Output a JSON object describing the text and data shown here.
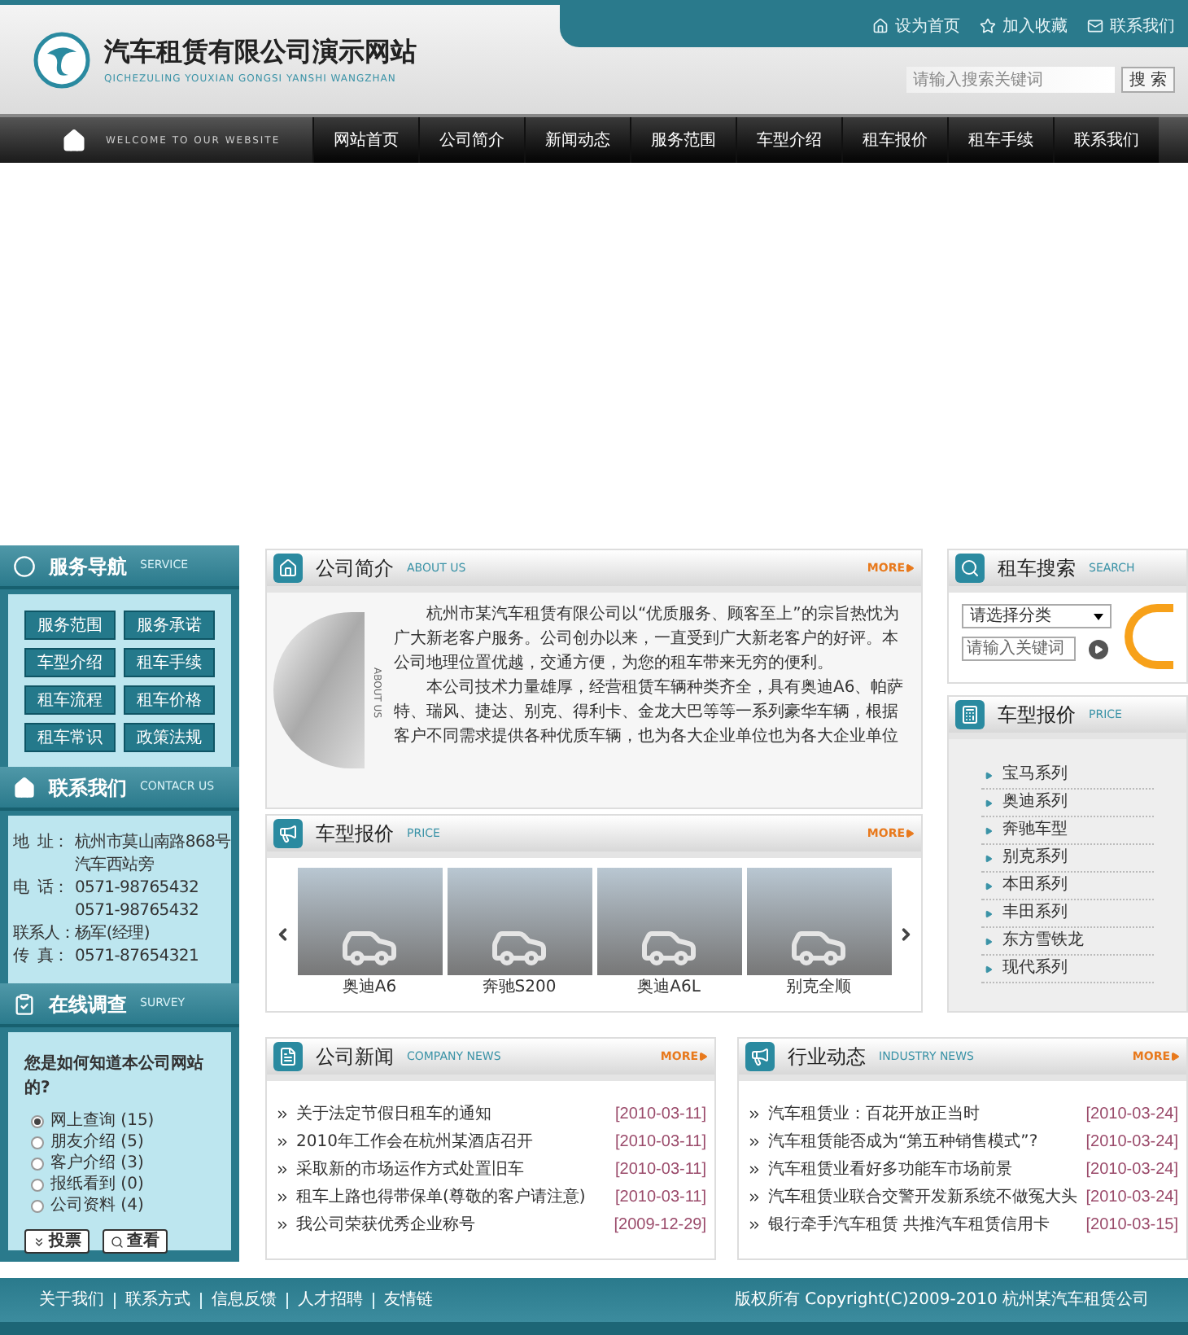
{
  "header": {
    "title": "汽车租赁有限公司演示网站",
    "subtitle": "QICHEZULING YOUXIAN GONGSI YANSHI WANGZHAN",
    "top_links": [
      {
        "label": "设为首页"
      },
      {
        "label": "加入收藏"
      },
      {
        "label": "联系我们"
      }
    ],
    "search": {
      "placeholder": "请输入搜索关键词",
      "button": "搜 索"
    }
  },
  "nav": {
    "welcome": "WELCOME TO OUR WEBSITE",
    "items": [
      "网站首页",
      "公司简介",
      "新闻动态",
      "服务范围",
      "车型介绍",
      "租车报价",
      "租车手续",
      "联系我们"
    ]
  },
  "service": {
    "title": "服务导航",
    "subtitle": "SERVICE",
    "items": [
      "服务范围",
      "服务承诺",
      "车型介绍",
      "租车手续",
      "租车流程",
      "租车价格",
      "租车常识",
      "政策法规"
    ]
  },
  "contact": {
    "title": "联系我们",
    "subtitle": "CONTACR US",
    "lines": [
      {
        "label": "地  址：",
        "value": "杭州市莫山南路868号"
      },
      {
        "value": "汽车西站旁"
      },
      {
        "label": "电  话：",
        "value": "0571-98765432"
      },
      {
        "value": "0571-98765432"
      },
      {
        "label": "联系人：",
        "value": "杨军(经理)"
      },
      {
        "label": "传  真：",
        "value": "0571-87654321"
      }
    ]
  },
  "survey": {
    "title": "在线调查",
    "subtitle": "SURVEY",
    "question": "您是如何知道本公司网站的?",
    "options": [
      {
        "label": "网上查询 (15)",
        "selected": true
      },
      {
        "label": "朋友介绍 (5)",
        "selected": false
      },
      {
        "label": "客户介绍 (3)",
        "selected": false
      },
      {
        "label": "报纸看到 (0)",
        "selected": false
      },
      {
        "label": "公司资料 (4)",
        "selected": false
      }
    ],
    "buttons": [
      "投票",
      "查看"
    ]
  },
  "about": {
    "title": "公司简介",
    "subtitle": "ABOUT US",
    "more": "MORE",
    "photo_label": "ABOUT US",
    "paragraphs": [
      "杭州市某汽车租赁有限公司以“优质服务、顾客至上”的宗旨热忱为广大新老客户服务。公司创办以来，一直受到广大新老客户的好评。本公司地理位置优越，交通方便，为您的租车带来无穷的便利。",
      "本公司技术力量雄厚，经营租赁车辆种类齐全，具有奥迪A6、帕萨特、瑞风、捷达、别克、得利卡、金龙大巴等等一系列豪华车辆，根据客户不同需求提供各种优质车辆，也为各大企业单位也为各大企业单位"
    ]
  },
  "price": {
    "title": "车型报价",
    "subtitle": "PRICE",
    "more": "MORE",
    "cars": [
      "奥迪A6",
      "奔驰S200",
      "奥迪A6L",
      "别克全顺"
    ]
  },
  "car_search": {
    "title": "租车搜索",
    "subtitle": "SEARCH",
    "select": "请选择分类",
    "placeholder": "请输入关键词"
  },
  "price_list": {
    "title": "车型报价",
    "subtitle": "PRICE",
    "items": [
      "宝马系列",
      "奥迪系列",
      "奔驰车型",
      "别克系列",
      "本田系列",
      "丰田系列",
      "东方雪铁龙",
      "现代系列"
    ]
  },
  "news": [
    {
      "title": "公司新闻",
      "subtitle": "COMPANY NEWS",
      "more": "MORE",
      "items": [
        {
          "text": "关于法定节假日租车的通知",
          "date": "[2010-03-11]"
        },
        {
          "text": "2010年工作会在杭州某酒店召开",
          "date": "[2010-03-11]"
        },
        {
          "text": "采取新的市场运作方式处置旧车",
          "date": "[2010-03-11]"
        },
        {
          "text": "租车上路也得带保单(尊敬的客户请注意)",
          "date": "[2010-03-11]"
        },
        {
          "text": "我公司荣获优秀企业称号",
          "date": "[2009-12-29]"
        }
      ]
    },
    {
      "title": "行业动态",
      "subtitle": "INDUSTRY NEWS",
      "more": "MORE",
      "items": [
        {
          "text": "汽车租赁业：百花开放正当时",
          "date": "[2010-03-24]"
        },
        {
          "text": "汽车租赁能否成为“第五种销售模式”?",
          "date": "[2010-03-24]"
        },
        {
          "text": "汽车租赁业看好多功能车市场前景",
          "date": "[2010-03-24]"
        },
        {
          "text": "汽车租赁业联合交警开发新系统不做冤大头",
          "date": "[2010-03-24]"
        },
        {
          "text": "银行牵手汽车租赁 共推汽车租赁信用卡",
          "date": "[2010-03-15]"
        }
      ]
    }
  ],
  "footer": {
    "links": [
      "关于我们",
      "联系方式",
      "信息反馈",
      "人才招聘",
      "友情链"
    ],
    "copyright": "版权所有 Copyright(C)2009-2010 杭州某汽车租赁公司"
  }
}
